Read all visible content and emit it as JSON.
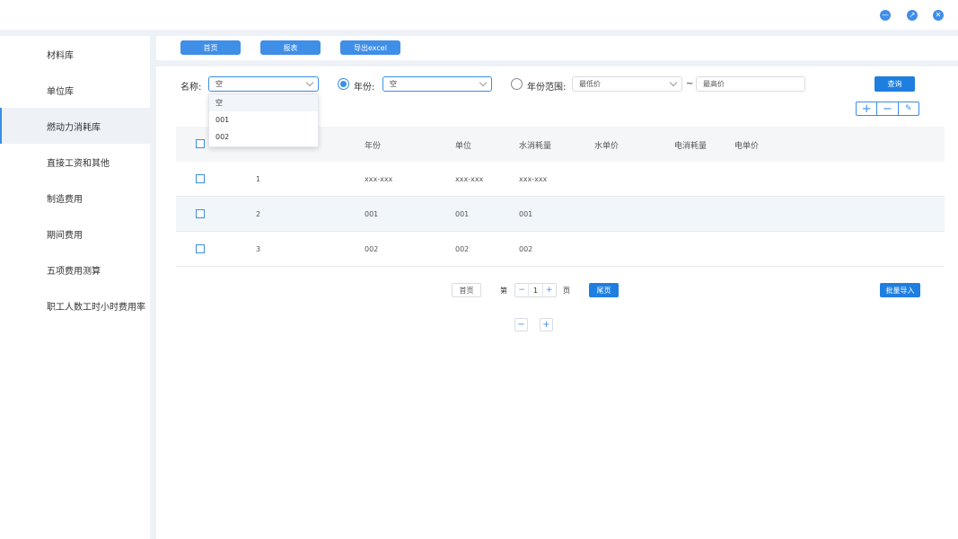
{
  "window_controls": {
    "minimize_icon": "minus-circle-icon",
    "maximize_icon": "expand-circle-icon",
    "close_icon": "close-circle-icon"
  },
  "sidebar": {
    "items": [
      {
        "label": "材料库",
        "active": false
      },
      {
        "label": "单位库",
        "active": false
      },
      {
        "label": "燃动力消耗库",
        "active": true
      },
      {
        "label": "直接工资和其他",
        "active": false
      },
      {
        "label": "制造费用",
        "active": false
      },
      {
        "label": "期间费用",
        "active": false
      },
      {
        "label": "五项费用测算",
        "active": false
      },
      {
        "label": "职工人数工时小时费用率",
        "active": false
      }
    ]
  },
  "toolbar": {
    "home_label": "首页",
    "report_label": "报表",
    "export_label": "导出excel"
  },
  "filters": {
    "name_label": "名称:",
    "name_value": "空",
    "name_options": [
      "空",
      "001",
      "002"
    ],
    "year_label": "年份:",
    "year_value": "空",
    "year_range_label": "年份范围:",
    "min_placeholder": "最低价",
    "tilde": "~",
    "max_placeholder": "最高价",
    "query_label": "查询"
  },
  "actions": {
    "add_icon": "plus-icon",
    "remove_icon": "minus-icon",
    "edit_icon": "edit-icon"
  },
  "table": {
    "columns": [
      "年份",
      "单位",
      "水消耗量",
      "水单价",
      "电消耗量",
      "电单价"
    ],
    "rows": [
      {
        "index": "1",
        "year": "xxx-xxx",
        "unit": "xxx-xxx",
        "water": "xxx-xxx"
      },
      {
        "index": "2",
        "year": "001",
        "unit": "001",
        "water": "001"
      },
      {
        "index": "3",
        "year": "002",
        "unit": "002",
        "water": "002"
      }
    ]
  },
  "pagination": {
    "first_label": "首页",
    "page_prefix": "第",
    "page_value": "1",
    "page_suffix": "页",
    "last_label": "尾页",
    "bulk_import_label": "批量导入"
  },
  "colors": {
    "accent": "#3a8ee6",
    "button": "#1f7fe0",
    "band": "#eef2f7"
  }
}
